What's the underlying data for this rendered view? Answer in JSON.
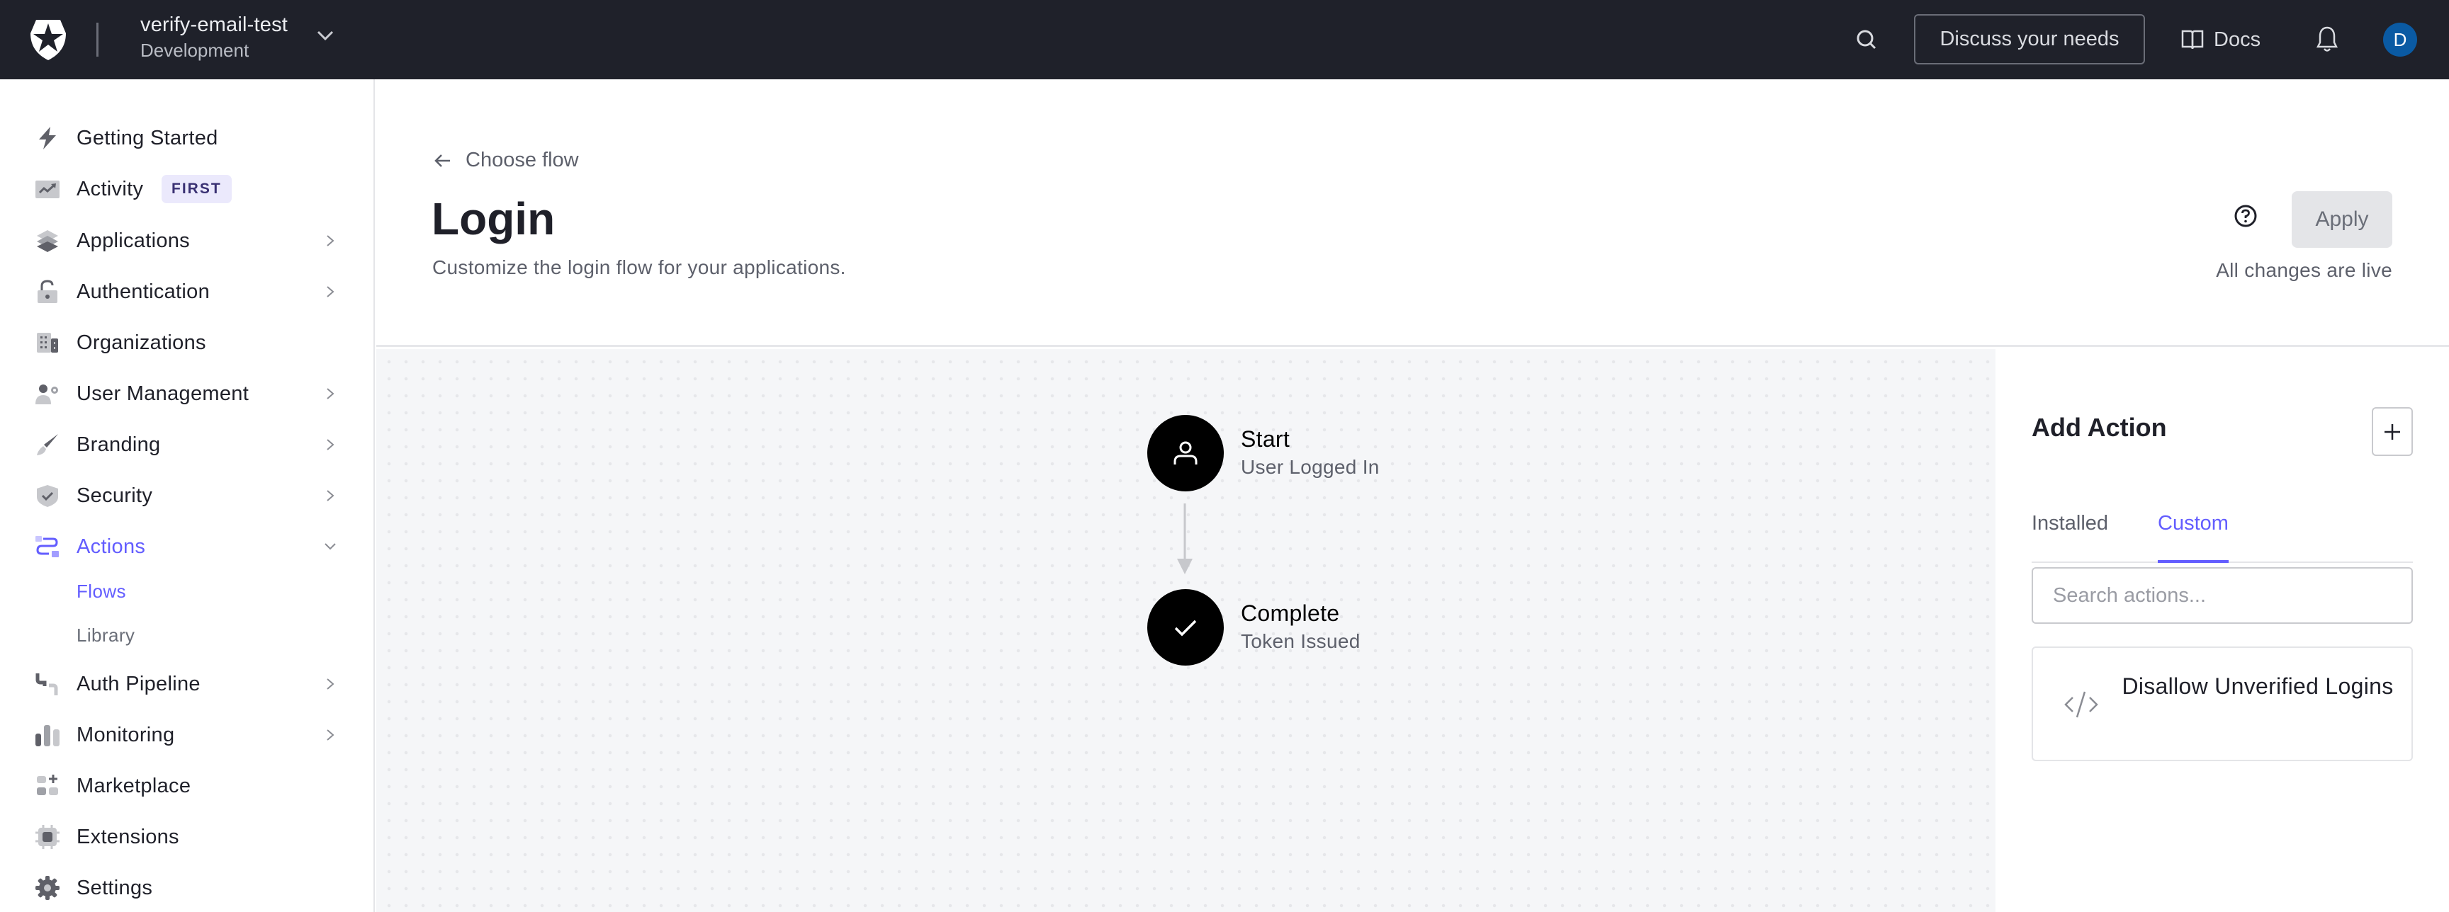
{
  "topbar": {
    "logo_icon": "auth0-shield-star-logo",
    "tenant_name": "verify-email-test",
    "tenant_env": "Development",
    "discuss_label": "Discuss your needs",
    "docs_label": "Docs",
    "avatar_initial": "D",
    "avatar_color": "#0a5aa3"
  },
  "sidebar": {
    "items": [
      {
        "label": "Getting Started",
        "icon": "bolt-icon",
        "chevron": false
      },
      {
        "label": "Activity",
        "icon": "trending-chart-icon",
        "chevron": false,
        "badge": "FIRST"
      },
      {
        "label": "Applications",
        "icon": "layers-icon",
        "chevron": true
      },
      {
        "label": "Authentication",
        "icon": "unlock-icon",
        "chevron": true
      },
      {
        "label": "Organizations",
        "icon": "building-icon",
        "chevron": false
      },
      {
        "label": "User Management",
        "icon": "user-gear-icon",
        "chevron": true
      },
      {
        "label": "Branding",
        "icon": "brush-icon",
        "chevron": true
      },
      {
        "label": "Security",
        "icon": "shield-check-icon",
        "chevron": true
      },
      {
        "label": "Actions",
        "icon": "actions-flow-icon",
        "chevron": true,
        "expanded": true,
        "active": true
      },
      {
        "label": "Auth Pipeline",
        "icon": "pipe-icon",
        "chevron": true
      },
      {
        "label": "Monitoring",
        "icon": "bar-chart-icon",
        "chevron": true
      },
      {
        "label": "Marketplace",
        "icon": "grid-plus-icon",
        "chevron": false
      },
      {
        "label": "Extensions",
        "icon": "chip-icon",
        "chevron": false
      },
      {
        "label": "Settings",
        "icon": "gear-icon",
        "chevron": false
      }
    ],
    "actions_subitems": [
      {
        "label": "Flows",
        "active": true
      },
      {
        "label": "Library",
        "active": false
      }
    ],
    "accent_color": "#635dff"
  },
  "header": {
    "back_label": "Choose flow",
    "title": "Login",
    "subtitle": "Customize the login flow for your applications.",
    "apply_label": "Apply",
    "status_text": "All changes are live"
  },
  "flow": {
    "nodes": [
      {
        "title": "Start",
        "subtitle": "User Logged In",
        "icon": "user-icon"
      },
      {
        "title": "Complete",
        "subtitle": "Token Issued",
        "icon": "check-icon"
      }
    ]
  },
  "panel": {
    "title": "Add Action",
    "tabs": [
      {
        "label": "Installed",
        "active": false
      },
      {
        "label": "Custom",
        "active": true
      }
    ],
    "search_placeholder": "Search actions...",
    "search_value": "",
    "actions": [
      {
        "label": "Disallow Unverified Logins",
        "icon": "code-icon"
      }
    ]
  }
}
